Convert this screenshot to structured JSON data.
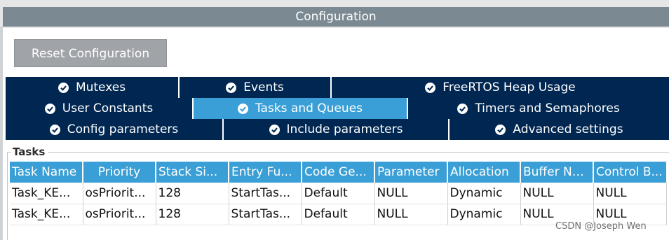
{
  "window": {
    "title": "Configuration"
  },
  "toolbar": {
    "reset_label": "Reset Configuration"
  },
  "tabs": {
    "row1": [
      "Mutexes",
      "Events",
      "FreeRTOS Heap Usage"
    ],
    "row2": [
      "User Constants",
      "Tasks and Queues",
      "Timers and Semaphores"
    ],
    "row3": [
      "Config parameters",
      "Include parameters",
      "Advanced settings"
    ],
    "active": "Tasks and Queues"
  },
  "tasks": {
    "legend": "Tasks",
    "columns": [
      "Task Name",
      "Priority",
      "Stack Si...",
      "Entry Fu...",
      "Code Ge...",
      "Parameter",
      "Allocation",
      "Buffer Na...",
      "Control B..."
    ],
    "rows": [
      [
        "Task_KE...",
        "osPriorit...",
        "128",
        "StartTas...",
        "Default",
        "NULL",
        "Dynamic",
        "NULL",
        "NULL"
      ],
      [
        "Task_KE...",
        "osPriorit...",
        "128",
        "StartTas...",
        "Default",
        "NULL",
        "Dynamic",
        "NULL",
        "NULL"
      ]
    ]
  },
  "watermark": "CSDN @Joseph Wen",
  "colors": {
    "tab_bg": "#002752",
    "tab_active": "#3a9fd6",
    "header_bg": "#3a9fd6",
    "button_bg": "#a0a4a8",
    "title_bg": "#7b8a92"
  }
}
